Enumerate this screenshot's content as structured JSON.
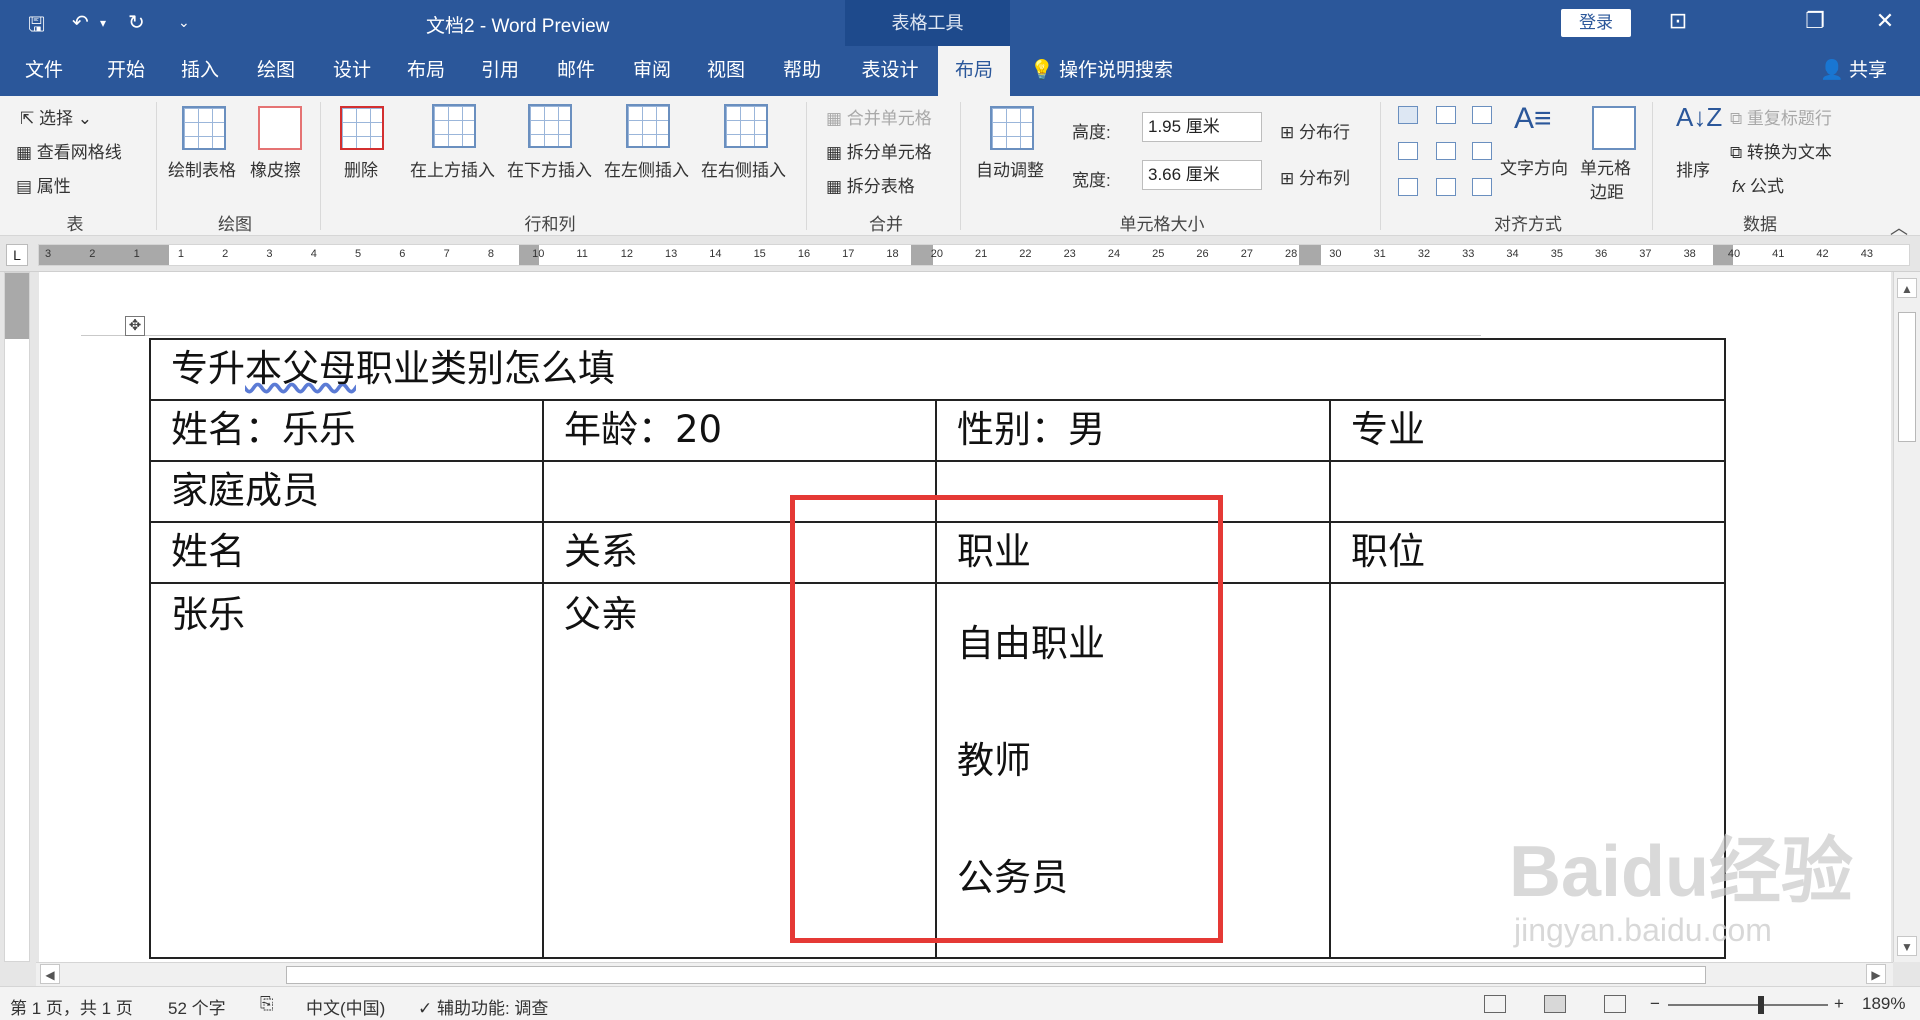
{
  "titlebar": {
    "title": "文档2  -  Word Preview",
    "tool_tab_title": "表格工具",
    "login": "登录",
    "save_icon": "save-icon",
    "undo_glyph": "↶",
    "redo_glyph": "↻",
    "save_glyph": "🖫",
    "dropdown_glyph": "▾",
    "customize_glyph": "⌄",
    "ribbon_opts_glyph": "⊡",
    "restore_glyph": "❐",
    "close_glyph": "✕"
  },
  "tabs": [
    "文件",
    "开始",
    "插入",
    "绘图",
    "设计",
    "布局",
    "引用",
    "邮件",
    "审阅",
    "视图",
    "帮助",
    "表设计",
    "布局"
  ],
  "active_tab_index": 12,
  "tellme": "操作说明搜索",
  "share": "共享",
  "ribbon": {
    "table_group": {
      "label": "表",
      "select": "选择",
      "view_gridlines": "查看网格线",
      "properties": "属性"
    },
    "draw_group": {
      "label": "绘图",
      "draw_table": "绘制表格",
      "eraser": "橡皮擦"
    },
    "rows_cols_group": {
      "label": "行和列",
      "delete": "删除",
      "insert_above": "在上方插入",
      "insert_below": "在下方插入",
      "insert_left": "在左侧插入",
      "insert_right": "在右侧插入"
    },
    "merge_group": {
      "label": "合并",
      "merge_cells": "合并单元格",
      "split_cells": "拆分单元格",
      "split_table": "拆分表格"
    },
    "cell_size_group": {
      "label": "单元格大小",
      "autofit": "自动调整",
      "height_label": "高度:",
      "height_value": "1.95 厘米",
      "width_label": "宽度:",
      "width_value": "3.66 厘米",
      "distribute_rows": "分布行",
      "distribute_cols": "分布列"
    },
    "align_group": {
      "label": "对齐方式",
      "text_direction": "文字方向",
      "cell_margins_1": "单元格",
      "cell_margins_2": "边距"
    },
    "data_group": {
      "label": "数据",
      "sort": "排序",
      "repeat_header": "重复标题行",
      "convert_text": "转换为文本",
      "formula": "公式"
    }
  },
  "ruler": {
    "numbers": [
      "3",
      "2",
      "1",
      "1",
      "2",
      "3",
      "4",
      "5",
      "6",
      "7",
      "8",
      "10",
      "11",
      "12",
      "13",
      "14",
      "15",
      "16",
      "17",
      "18",
      "20",
      "21",
      "22",
      "23",
      "24",
      "25",
      "26",
      "27",
      "28",
      "30",
      "31",
      "32",
      "33",
      "34",
      "35",
      "36",
      "37",
      "38",
      "40",
      "41",
      "42",
      "43"
    ]
  },
  "document": {
    "title_row": "专升本父母职业类别怎么填",
    "title_underlined_part": "本父母",
    "title_prefix": "专升",
    "title_suffix": "职业类别怎么填",
    "row1": [
      "姓名：乐乐",
      "年龄：20",
      "性别：男",
      "专业"
    ],
    "row2": [
      "家庭成员",
      "",
      "",
      ""
    ],
    "row3": [
      "姓名",
      "关系",
      "职业",
      "职位"
    ],
    "row4": {
      "name": "张乐",
      "relation": "父亲",
      "occupations": [
        "自由职业",
        "教师",
        "公务员"
      ],
      "position": ""
    }
  },
  "watermark": {
    "brand": "Baidu经验",
    "url": "jingyan.baidu.com"
  },
  "statusbar": {
    "page": "第 1 页，共 1 页",
    "words": "52 个字",
    "language": "中文(中国)",
    "accessibility": "辅助功能: 调查",
    "zoom": "189%",
    "zoom_minus": "−",
    "zoom_plus": "+"
  },
  "colors": {
    "accent": "#2b579a",
    "highlight_box": "#e53935"
  }
}
